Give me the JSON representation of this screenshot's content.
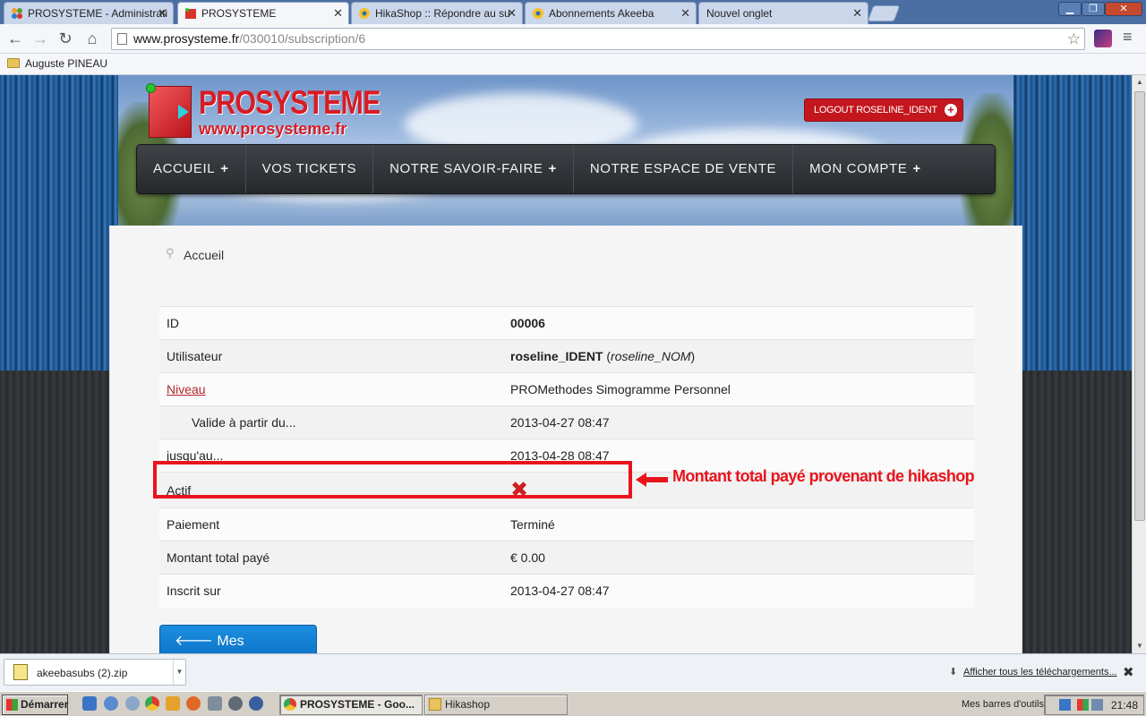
{
  "browser": {
    "tabs": [
      {
        "title": "PROSYSTEME - Administrati",
        "active": false
      },
      {
        "title": "PROSYSTEME",
        "active": true
      },
      {
        "title": "HikaShop :: Répondre au su",
        "active": false
      },
      {
        "title": "Abonnements Akeeba",
        "active": false
      },
      {
        "title": "Nouvel onglet",
        "active": false
      }
    ],
    "url_host": "www.prosysteme.fr",
    "url_path": "/030010/subscription/6",
    "bookmark": "Auguste PINEAU"
  },
  "site": {
    "logo_title": "PROSYSTEME",
    "logo_url": "www.prosysteme.fr",
    "logout_label": "LOGOUT ROSELINE_IDENT",
    "nav": [
      {
        "label": "ACCUEIL",
        "has_sub": true
      },
      {
        "label": "VOS TICKETS",
        "has_sub": false
      },
      {
        "label": "NOTRE SAVOIR-FAIRE",
        "has_sub": true
      },
      {
        "label": "NOTRE ESPACE DE VENTE",
        "has_sub": false
      },
      {
        "label": "MON COMPTE",
        "has_sub": true
      }
    ],
    "breadcrumb": "Accueil"
  },
  "subscription": {
    "id_label": "ID",
    "id_value": "00006",
    "user_label": "Utilisateur",
    "user_ident": "roseline_IDENT",
    "user_name": "roseline_NOM",
    "level_label": "Niveau",
    "level_value": "PROMethodes Simogramme Personnel",
    "valid_from_label": "Valide à partir du...",
    "valid_from_value": "2013-04-27 08:47",
    "valid_to_label": "jusqu'au...",
    "valid_to_value": "2013-04-28 08:47",
    "active_label": "Actif",
    "active_value": false,
    "payment_label": "Paiement",
    "payment_value": "Terminé",
    "amount_label": "Montant total payé",
    "amount_value": "€ 0.00",
    "created_label": "Inscrit sur",
    "created_value": "2013-04-27 08:47",
    "back_button": "Mes abonnements"
  },
  "annotation": {
    "text": "Montant total payé provenant de hikashop",
    "color": "#e8141c"
  },
  "downloads": {
    "file": "akeebasubs (2).zip",
    "show_all": "Afficher tous les téléchargements..."
  },
  "taskbar": {
    "start": "Démarrer",
    "tasks": [
      "PROSYSTEME - Goo...",
      "Hikashop"
    ],
    "toolbars": "Mes barres d'outils",
    "clock": "21:48"
  }
}
